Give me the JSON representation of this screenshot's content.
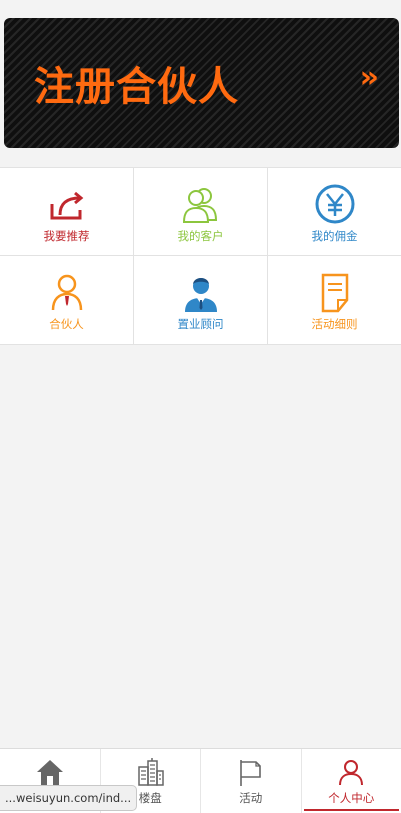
{
  "banner": {
    "title": "注册合伙人",
    "arrow": "»"
  },
  "grid": {
    "items": [
      {
        "label": "我要推荐",
        "icon": "share-arrow-icon",
        "color": "#c0272d"
      },
      {
        "label": "我的客户",
        "icon": "customers-icon",
        "color": "#8cc63e"
      },
      {
        "label": "我的佣金",
        "icon": "yen-icon",
        "color": "#2f87c8"
      },
      {
        "label": "合伙人",
        "icon": "partner-icon",
        "color": "#f7941d"
      },
      {
        "label": "置业顾问",
        "icon": "consultant-icon",
        "color": "#2f87c8"
      },
      {
        "label": "活动细则",
        "icon": "document-icon",
        "color": "#f7941d"
      }
    ]
  },
  "tabbar": {
    "items": [
      {
        "label": "",
        "icon": "home-icon"
      },
      {
        "label": "楼盘",
        "icon": "building-icon"
      },
      {
        "label": "活动",
        "icon": "flag-icon"
      },
      {
        "label": "个人中心",
        "icon": "user-icon",
        "active": true
      }
    ]
  },
  "status_url": "...weisuyun.com/ind..."
}
